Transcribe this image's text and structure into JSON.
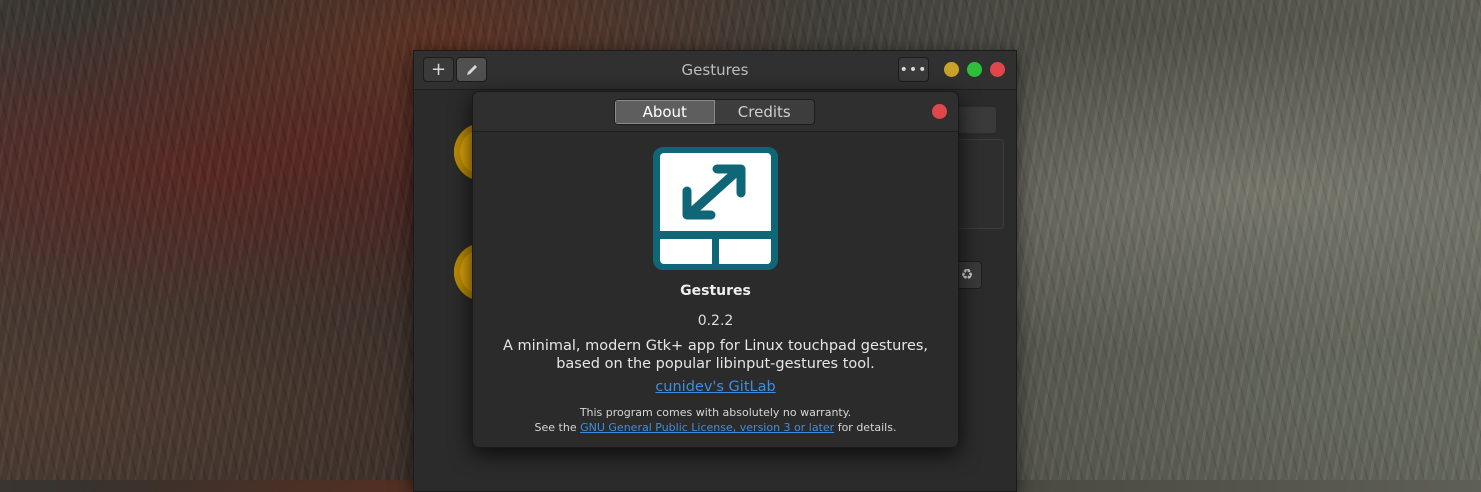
{
  "main_window": {
    "title": "Gestures",
    "add_label": "+",
    "edit_icon": "pencil-icon",
    "menu_label": "•••",
    "recycle_icon": "recycle-icon",
    "window_controls": {
      "minimize_color": "#c9a227",
      "maximize_color": "#2ebf3a",
      "close_color": "#e0464b"
    }
  },
  "about_dialog": {
    "tabs": [
      {
        "label": "About",
        "active": true
      },
      {
        "label": "Credits",
        "active": false
      }
    ],
    "app_name": "Gestures",
    "version": "0.2.2",
    "description": "A minimal, modern Gtk+ app for Linux touchpad gestures, based on the popular libinput-gestures tool.",
    "website_label": "cunidev's GitLab",
    "warranty_text": "This program comes with absolutely no warranty.",
    "license_prefix": "See the",
    "license_link": "GNU General Public License, version 3 or later",
    "license_suffix": "for details.",
    "logo": {
      "icon": "touchpad-resize-icon",
      "color": "#0f6677"
    },
    "link_color": "#3d8ee2"
  }
}
